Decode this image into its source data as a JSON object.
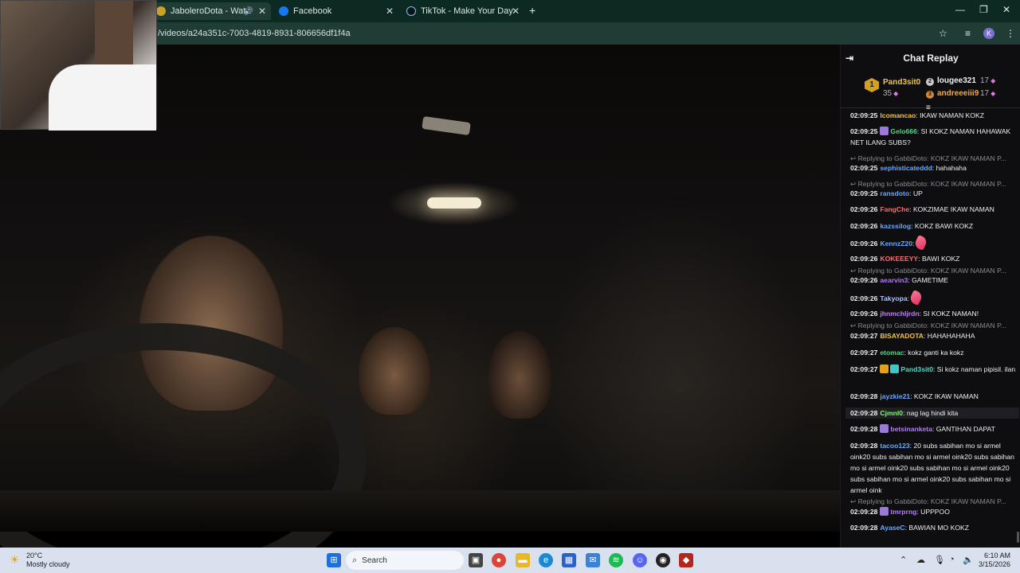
{
  "browser": {
    "tabs": [
      {
        "title": "JaboleroDota - Watch the V",
        "active": true,
        "fav_color": "#c9a227"
      },
      {
        "title": "Facebook",
        "active": false,
        "fav_color": "#1877f2"
      },
      {
        "title": "TikTok - Make Your Day",
        "active": false,
        "fav_color": "#111111"
      }
    ],
    "url": "/videos/a24a351c-7003-4819-8931-806656df1f4a",
    "new_tab_icon": "+",
    "profile_initial": "K"
  },
  "chat": {
    "title": "Chat Replay",
    "leaderboard": {
      "first": {
        "rank": "1",
        "name": "Pand3sit0",
        "points": "35"
      },
      "second": {
        "name": "lougee321",
        "points": "17"
      },
      "third": {
        "name": "andreeeiii9",
        "points": "17"
      }
    },
    "messages": [
      {
        "ts": "02:09:25",
        "user": "lcomancao",
        "color": "#f5c542",
        "text": ": IKAW NAMAN KOKZ"
      },
      {
        "ts": "02:09:25",
        "user": "Gelo666",
        "color": "#4ddc83",
        "text": ": SI KOKZ NAMAN HAHAWAK NET ILANG SUBS?",
        "badge": "#9a7ad6"
      },
      {
        "reply": "Replying to GabbiDoto: KOKZ IKAW NAMAN P..."
      },
      {
        "ts": "02:09:25",
        "user": "sephisticateddd",
        "color": "#6aa8ff",
        "text": ": hahahaha"
      },
      {
        "reply": "Replying to GabbiDoto: KOKZ IKAW NAMAN P..."
      },
      {
        "ts": "02:09:25",
        "user": "ransdoto",
        "color": "#6aa8ff",
        "text": ": UP"
      },
      {
        "ts": "02:09:26",
        "user": "FangChe",
        "color": "#ff6b6b",
        "text": ": KOKZIMAE IKAW NAMAN"
      },
      {
        "ts": "02:09:26",
        "user": "kazssilog",
        "color": "#6aa8ff",
        "text": ": KOKZ BAWI KOKZ"
      },
      {
        "ts": "02:09:26",
        "user": "KennzZ20",
        "color": "#6aa8ff",
        "text": ":",
        "emote": true
      },
      {
        "ts": "02:09:26",
        "user": "KOKEEEYY",
        "color": "#ff6b6b",
        "text": ": BAWI KOKZ"
      },
      {
        "reply": "Replying to GabbiDoto: KOKZ IKAW NAMAN P..."
      },
      {
        "ts": "02:09:26",
        "user": "aearvin3",
        "color": "#b57aff",
        "text": ": GAMETIME"
      },
      {
        "ts": "02:09:26",
        "user": "Takyopa",
        "color": "#b0c4ff",
        "text": ":",
        "emote": true
      },
      {
        "ts": "02:09:26",
        "user": "jhnmchljrdn",
        "color": "#c77dff",
        "text": ": SI KOKZ NAMAN!"
      },
      {
        "reply": "Replying to GabbiDoto: KOKZ IKAW NAMAN P..."
      },
      {
        "ts": "02:09:27",
        "user": "BISAYADOTA",
        "color": "#f5c542",
        "text": ": HAHAHAHAHA"
      },
      {
        "ts": "02:09:27",
        "user": "etomac",
        "color": "#4ddc83",
        "text": ": kokz ganti ka kokz"
      },
      {
        "ts": "02:09:27",
        "user": "Pand3sit0",
        "color": "#4ddcc8",
        "text": ": Si kokz naman pipisil. ilan",
        "badge": "#e0a020",
        "badge2": "#3fc7c7"
      },
      {
        "ts": "02:09:28",
        "user": "jayzkie21",
        "color": "#6aa8ff",
        "text": ": KOKZ IKAW NAMAN"
      },
      {
        "ts": "02:09:28",
        "user": "Cjmnl0",
        "color": "#7dff6b",
        "text": ": nag lag hindi kita",
        "hl": true
      },
      {
        "ts": "02:09:28",
        "user": "betsinanketa",
        "color": "#b57aff",
        "text": ": GANTIHAN DAPAT",
        "badge": "#9a7ad6"
      },
      {
        "ts": "02:09:28",
        "user": "tacoo123",
        "color": "#6aa8ff",
        "text": ": 20 subs sabihan mo si armel oink20 subs sabihan mo si armel oink20 subs sabihan mo si armel oink20 subs sabihan mo si armel oink20 subs sabihan mo si armel oink20 subs sabihan mo si armel oink"
      },
      {
        "reply": "Replying to GabbiDoto: KOKZ IKAW NAMAN P..."
      },
      {
        "ts": "02:09:28",
        "user": "tmrprng",
        "color": "#b57aff",
        "text": ": UPPPOO",
        "badge": "#9a7ad6"
      },
      {
        "ts": "02:09:28",
        "user": "AyaseC",
        "color": "#6aa8ff",
        "text": ": BAWIAN MO KOKZ"
      }
    ]
  },
  "taskbar": {
    "weather_temp": "20°C",
    "weather_desc": "Mostly cloudy",
    "search_placeholder": "Search",
    "time": "6:10 AM",
    "date": "3/15/2026"
  }
}
